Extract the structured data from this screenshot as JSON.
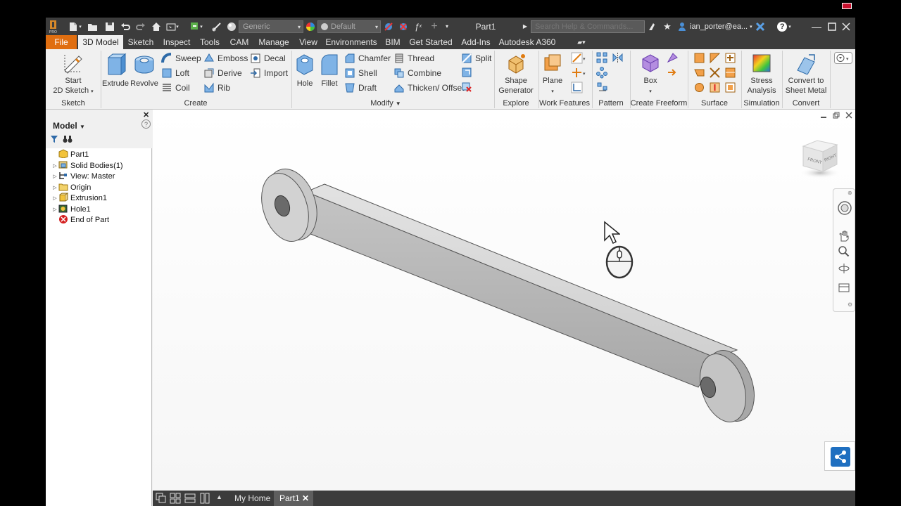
{
  "titlebar": {
    "app_logo_label": "PRO",
    "material_combo": "Generic",
    "appearance_combo": "Default",
    "document_title": "Part1",
    "search_placeholder": "Search Help & Commands...",
    "user_name": "ian_porter@ea...",
    "help_label": "?"
  },
  "tabs": [
    "File",
    "3D Model",
    "Sketch",
    "Inspect",
    "Tools",
    "CAM",
    "Manage",
    "View",
    "Environments",
    "BIM",
    "Get Started",
    "Add-Ins",
    "Autodesk A360"
  ],
  "active_tab": "3D Model",
  "ribbon": {
    "sketch": {
      "title": "Sketch",
      "start_sketch_line1": "Start",
      "start_sketch_line2": "2D Sketch"
    },
    "create": {
      "title": "Create",
      "extrude": "Extrude",
      "revolve": "Revolve",
      "sweep": "Sweep",
      "loft": "Loft",
      "coil": "Coil",
      "emboss": "Emboss",
      "derive": "Derive",
      "rib": "Rib",
      "decal": "Decal",
      "import": "Import"
    },
    "modify": {
      "title": "Modify",
      "hole": "Hole",
      "fillet": "Fillet",
      "chamfer": "Chamfer",
      "shell": "Shell",
      "draft": "Draft",
      "thread": "Thread",
      "combine": "Combine",
      "thicken": "Thicken/ Offset",
      "split": "Split"
    },
    "explore": {
      "title": "Explore",
      "shape_generator_line1": "Shape",
      "shape_generator_line2": "Generator"
    },
    "work_features": {
      "title": "Work Features",
      "plane": "Plane"
    },
    "pattern": {
      "title": "Pattern"
    },
    "create_freeform": {
      "title": "Create Freeform",
      "box": "Box"
    },
    "surface": {
      "title": "Surface"
    },
    "simulation": {
      "title": "Simulation",
      "stress_line1": "Stress",
      "stress_line2": "Analysis"
    },
    "convert": {
      "title": "Convert",
      "line1": "Convert to",
      "line2": "Sheet Metal"
    }
  },
  "browser": {
    "title": "Model",
    "tree": [
      {
        "label": "Part1",
        "icon": "part-icon",
        "expandable": false,
        "indent": 0
      },
      {
        "label": "Solid Bodies(1)",
        "icon": "solid-bodies-icon",
        "expandable": true,
        "indent": 1
      },
      {
        "label": "View: Master",
        "icon": "view-icon",
        "expandable": true,
        "indent": 1
      },
      {
        "label": "Origin",
        "icon": "folder-icon",
        "expandable": true,
        "indent": 1
      },
      {
        "label": "Extrusion1",
        "icon": "extrusion-icon",
        "expandable": true,
        "indent": 1
      },
      {
        "label": "Hole1",
        "icon": "hole-icon",
        "expandable": true,
        "indent": 1
      },
      {
        "label": "End of Part",
        "icon": "end-of-part-icon",
        "expandable": false,
        "indent": 1
      }
    ]
  },
  "viewcube": {
    "front": "FRONT",
    "right": "RIGHT"
  },
  "document_tabs": {
    "home": "My Home",
    "part": "Part1"
  },
  "colors": {
    "file_tab": "#e06e10",
    "chrome_dark": "#3c3c3c",
    "accent_blue": "#1f6fc0"
  }
}
